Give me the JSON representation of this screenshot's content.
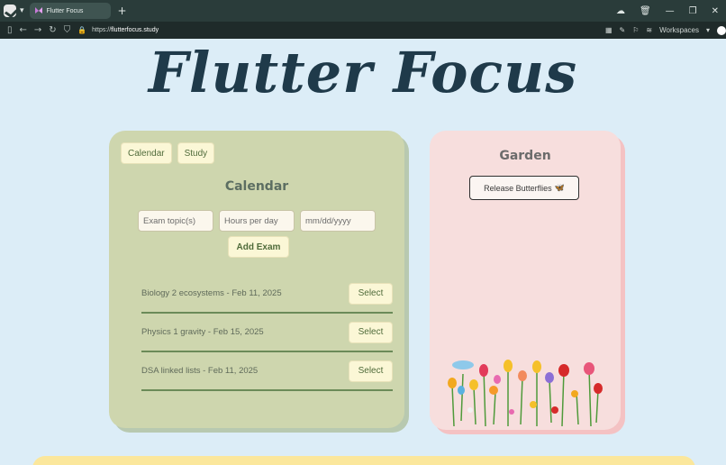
{
  "browser": {
    "tab_title": "Flutter Focus",
    "url_prefix": "https://",
    "url_host": "flutterfocus.study",
    "workspaces_label": "Workspaces"
  },
  "page": {
    "title": "Flutter Focus"
  },
  "calendar": {
    "tabs": [
      {
        "label": "Calendar"
      },
      {
        "label": "Study"
      }
    ],
    "heading": "Calendar",
    "inputs": {
      "topic_placeholder": "Exam topic(s)",
      "hours_placeholder": "Hours per day",
      "date_placeholder": "mm/dd/yyyy"
    },
    "add_label": "Add Exam",
    "exams": [
      {
        "text": "Biology 2 ecosystems - Feb 11, 2025",
        "action": "Select"
      },
      {
        "text": "Physics 1 gravity - Feb 15, 2025",
        "action": "Select"
      },
      {
        "text": "DSA linked lists - Feb 11, 2025",
        "action": "Select"
      }
    ]
  },
  "garden": {
    "heading": "Garden",
    "release_label": "Release Butterflies",
    "release_emoji": "🦋"
  },
  "colors": {
    "calendar_bg": "#ced6ae",
    "garden_bg": "#f7dedd",
    "title": "#1f3a4a",
    "accent_button": "#fbf7d6"
  }
}
